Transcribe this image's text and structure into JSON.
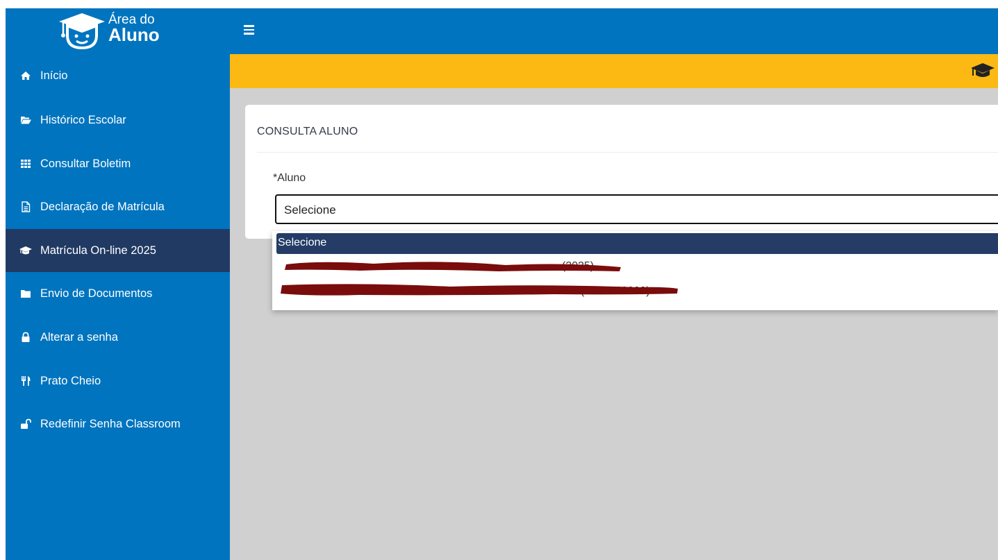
{
  "app": {
    "logo_line1": "Área do",
    "logo_line2": "Aluno"
  },
  "sidebar": {
    "items": [
      {
        "label": "Início",
        "icon": "home-icon"
      },
      {
        "label": "Histórico Escolar",
        "icon": "folder-open-icon"
      },
      {
        "label": "Consultar Boletim",
        "icon": "grid-icon"
      },
      {
        "label": "Declaração de Matrícula",
        "icon": "document-icon"
      },
      {
        "label": "Matrícula On-line 2025",
        "icon": "graduation-cap-icon",
        "active": true
      },
      {
        "label": "Envio de Documentos",
        "icon": "folder-icon"
      },
      {
        "label": "Alterar a senha",
        "icon": "lock-icon"
      },
      {
        "label": "Prato Cheio",
        "icon": "cutlery-icon"
      },
      {
        "label": "Redefinir Senha Classroom",
        "icon": "unlock-icon"
      }
    ]
  },
  "card": {
    "title": "CONSULTA ALUNO",
    "field_label": "*Aluno",
    "select_value": "Selecione"
  },
  "dropdown": {
    "options": [
      {
        "label": "Selecione",
        "selected": true
      },
      {
        "label": "(2025)",
        "redacted": true
      },
      {
        "label": "(7000000000)",
        "redacted": true
      }
    ]
  },
  "colors": {
    "primary": "#0074bf",
    "active_nav": "#213a63",
    "accent_yellow": "#fdb913",
    "content_bg": "#d0d0d0",
    "redaction": "#7a0c0c"
  }
}
